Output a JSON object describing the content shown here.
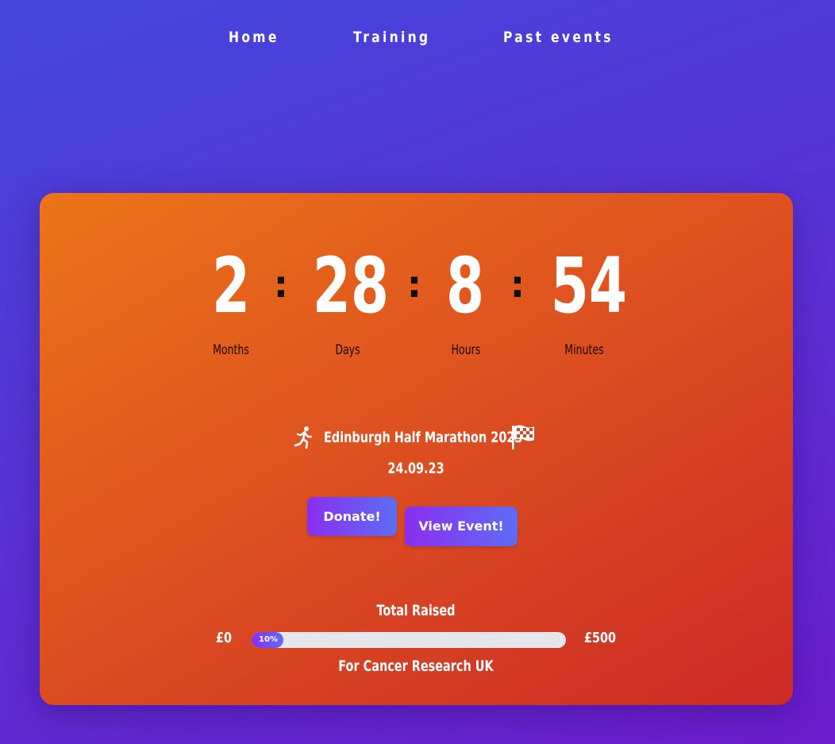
{
  "nav": {
    "items": [
      {
        "label": "Home"
      },
      {
        "label": "Training"
      },
      {
        "label": "Past events"
      }
    ]
  },
  "countdown": {
    "months": {
      "value": "2",
      "label": "Months"
    },
    "days": {
      "value": "28",
      "label": "Days"
    },
    "hours": {
      "value": "8",
      "label": "Hours"
    },
    "minutes": {
      "value": "54",
      "label": "Minutes"
    },
    "separator": ":"
  },
  "event": {
    "name": "Edinburgh Half Marathon 2023",
    "date": "24.09.23",
    "icons": {
      "left": "runner-icon",
      "right": "checkered-flag-icon"
    }
  },
  "actions": {
    "donate_label": "Donate!",
    "view_event_label": "View Event!"
  },
  "fundraising": {
    "title": "Total Raised",
    "min_label": "£0",
    "max_label": "£500",
    "progress_percent": 10,
    "progress_text": "10%",
    "charity": "For Cancer Research UK"
  },
  "colors": {
    "page_gradient_start": "#4446dc",
    "page_gradient_end": "#6a1ccc",
    "card_gradient_start": "#ec7419",
    "card_gradient_end": "#cd2a26",
    "button_gradient_start": "#8a2ef0",
    "button_gradient_end": "#5e6cf4",
    "progress_track": "#e6e7ec"
  }
}
